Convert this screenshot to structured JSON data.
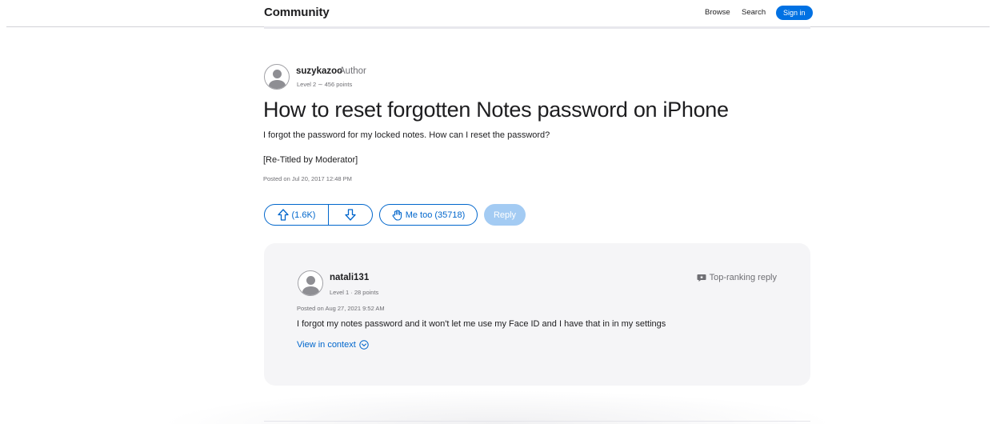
{
  "nav": {
    "brand": "Community",
    "browse": "Browse",
    "search": "Search",
    "signin": "Sign in"
  },
  "question": {
    "author": "suzykazoo",
    "role": "Author",
    "level": "Level 2 ∼ 456 points",
    "title": "How to reset forgotten Notes password on iPhone",
    "body": "I forgot the password for my locked notes. How can I reset the password?",
    "note": "[Re-Titled by Moderator]",
    "posted": "Posted on Jul 20, 2017 12:48 PM",
    "upvotes": "(1.6K)",
    "me_too": "Me too (35718)",
    "reply": "Reply"
  },
  "top_reply": {
    "author": "natali131",
    "level": "Level 1  ·  28 points",
    "badge": "Top-ranking reply",
    "posted": "Posted on Aug 27, 2021 9:52 AM",
    "body": "I forgot my notes password and it won't let me use my Face ID and I have that in in my settings",
    "link": "View in context"
  },
  "colors": {
    "accent": "#0066cc",
    "signin_bg": "#0071e3",
    "reply_disabled": "#a3cbf3",
    "card_bg": "#f5f5f7"
  },
  "icons": [
    "avatar-icon",
    "arrow-up-icon",
    "arrow-down-icon",
    "raised-hand-icon",
    "speech-bubble-icon",
    "chevron-down-circle-icon"
  ]
}
